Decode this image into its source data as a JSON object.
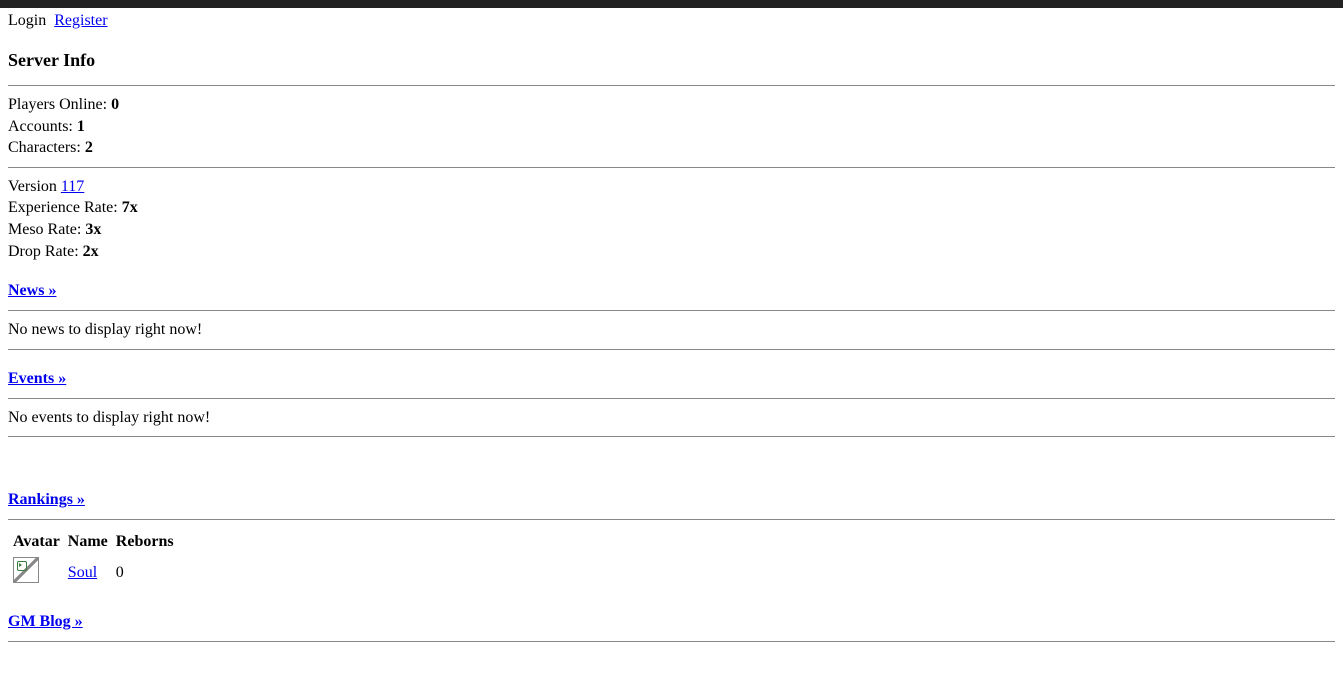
{
  "auth": {
    "login": "Login",
    "register": "Register"
  },
  "serverInfo": {
    "heading": "Server Info",
    "playersOnline": {
      "label": "Players Online: ",
      "value": "0"
    },
    "accounts": {
      "label": "Accounts: ",
      "value": "1"
    },
    "characters": {
      "label": "Characters: ",
      "value": "2"
    },
    "version": {
      "label": "Version ",
      "value": "117"
    },
    "expRate": {
      "label": "Experience Rate: ",
      "value": "7x"
    },
    "mesoRate": {
      "label": "Meso Rate: ",
      "value": "3x"
    },
    "dropRate": {
      "label": "Drop Rate: ",
      "value": "2x"
    }
  },
  "news": {
    "heading": "News »",
    "empty": "No news to display right now!"
  },
  "events": {
    "heading": "Events »",
    "empty": "No events to display right now!"
  },
  "rankings": {
    "heading": "Rankings »",
    "columns": {
      "avatar": "Avatar",
      "name": "Name",
      "reborns": "Reborns"
    },
    "rows": [
      {
        "name": "Soul",
        "reborns": "0"
      }
    ]
  },
  "gmblog": {
    "heading": "GM Blog »"
  }
}
